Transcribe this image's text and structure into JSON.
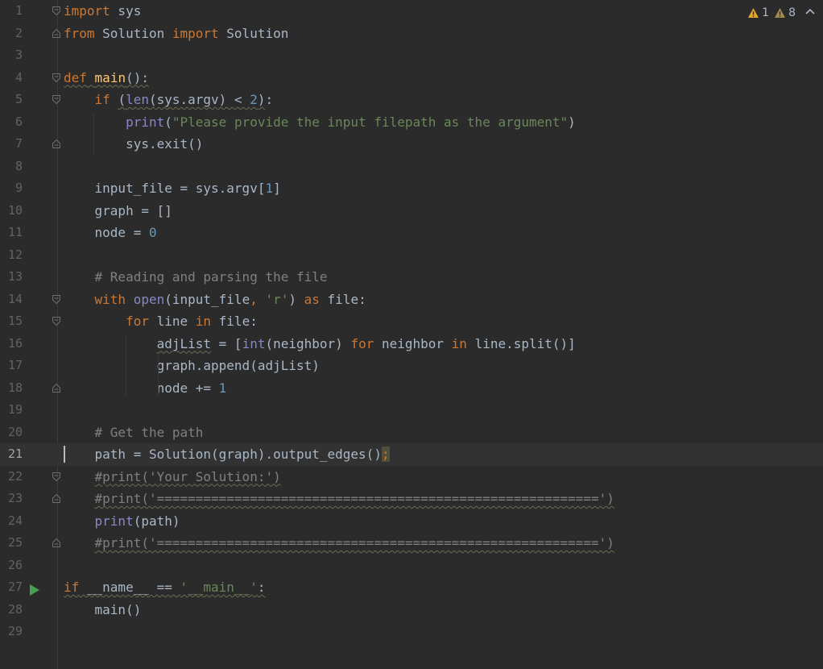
{
  "editor": {
    "current_line": 21,
    "inspections": {
      "warnings_count": "1",
      "weak_warnings_count": "8",
      "warning_color": "#e0a533",
      "weak_warning_color": "#a38b4b",
      "expand_icon": "chevron-up-icon"
    },
    "colors": {
      "background": "#2b2b2b",
      "keyword": "#cc7832",
      "string": "#6a8759",
      "number": "#6897bb",
      "comment": "#808080",
      "function_def": "#ffc66d",
      "builtin": "#8888c6",
      "run_icon": "#499c54"
    },
    "lines": [
      {
        "n": "1",
        "fold": "start",
        "tokens": [
          {
            "t": "import",
            "c": "kw"
          },
          {
            "t": " sys",
            "c": "pl"
          }
        ]
      },
      {
        "n": "2",
        "fold": "end",
        "tokens": [
          {
            "t": "from",
            "c": "kw"
          },
          {
            "t": " Solution ",
            "c": "pl"
          },
          {
            "t": "import",
            "c": "kw"
          },
          {
            "t": " Solution",
            "c": "pl"
          }
        ]
      },
      {
        "n": "3",
        "tokens": []
      },
      {
        "n": "4",
        "fold": "start",
        "tokens": [
          {
            "t": "def",
            "c": "kw sq"
          },
          {
            "t": " ",
            "c": "pl sq"
          },
          {
            "t": "main",
            "c": "fn sq"
          },
          {
            "t": "():",
            "c": "pl sq"
          }
        ]
      },
      {
        "n": "5",
        "fold": "start",
        "tokens": [
          {
            "t": "    "
          },
          {
            "t": "if",
            "c": "kw"
          },
          {
            "t": " ",
            "c": "pl"
          },
          {
            "t": "(",
            "c": "pl sq"
          },
          {
            "t": "len",
            "c": "bi sq"
          },
          {
            "t": "(sys.argv) < ",
            "c": "pl sq"
          },
          {
            "t": "2",
            "c": "num sq"
          },
          {
            "t": ")",
            "c": "pl sq"
          },
          {
            "t": ":",
            "c": "pl"
          }
        ]
      },
      {
        "n": "6",
        "tokens": [
          {
            "t": "        "
          },
          {
            "t": "print",
            "c": "bi"
          },
          {
            "t": "(",
            "c": "pl"
          },
          {
            "t": "\"Please provide the input filepath as the argument\"",
            "c": "str"
          },
          {
            "t": ")",
            "c": "pl"
          }
        ]
      },
      {
        "n": "7",
        "fold": "end",
        "tokens": [
          {
            "t": "        sys.exit()",
            "c": "pl"
          }
        ]
      },
      {
        "n": "8",
        "tokens": []
      },
      {
        "n": "9",
        "tokens": [
          {
            "t": "    input_file = sys.argv[",
            "c": "pl"
          },
          {
            "t": "1",
            "c": "num"
          },
          {
            "t": "]",
            "c": "pl"
          }
        ]
      },
      {
        "n": "10",
        "tokens": [
          {
            "t": "    graph = []",
            "c": "pl"
          }
        ]
      },
      {
        "n": "11",
        "tokens": [
          {
            "t": "    node = ",
            "c": "pl"
          },
          {
            "t": "0",
            "c": "num"
          }
        ]
      },
      {
        "n": "12",
        "tokens": []
      },
      {
        "n": "13",
        "tokens": [
          {
            "t": "    "
          },
          {
            "t": "# Reading and parsing the file",
            "c": "com"
          }
        ]
      },
      {
        "n": "14",
        "fold": "start",
        "tokens": [
          {
            "t": "    "
          },
          {
            "t": "with",
            "c": "kw"
          },
          {
            "t": " ",
            "c": "pl"
          },
          {
            "t": "open",
            "c": "bi"
          },
          {
            "t": "(input_file",
            "c": "pl"
          },
          {
            "t": ", ",
            "c": "kw"
          },
          {
            "t": "'r'",
            "c": "str"
          },
          {
            "t": ") ",
            "c": "pl"
          },
          {
            "t": "as",
            "c": "kw"
          },
          {
            "t": " file:",
            "c": "pl"
          }
        ]
      },
      {
        "n": "15",
        "fold": "start",
        "tokens": [
          {
            "t": "        "
          },
          {
            "t": "for",
            "c": "kw"
          },
          {
            "t": " line ",
            "c": "pl"
          },
          {
            "t": "in",
            "c": "kw"
          },
          {
            "t": " file:",
            "c": "pl"
          }
        ]
      },
      {
        "n": "16",
        "tokens": [
          {
            "t": "            "
          },
          {
            "t": "adjList",
            "c": "pl sq"
          },
          {
            "t": " = [",
            "c": "pl"
          },
          {
            "t": "int",
            "c": "bi"
          },
          {
            "t": "(neighbor) ",
            "c": "pl"
          },
          {
            "t": "for",
            "c": "kw"
          },
          {
            "t": " neighbor ",
            "c": "pl"
          },
          {
            "t": "in",
            "c": "kw"
          },
          {
            "t": " line.split()]",
            "c": "pl"
          }
        ]
      },
      {
        "n": "17",
        "tokens": [
          {
            "t": "            graph.append(adjList)",
            "c": "pl"
          }
        ]
      },
      {
        "n": "18",
        "fold": "end",
        "tokens": [
          {
            "t": "            node += ",
            "c": "pl"
          },
          {
            "t": "1",
            "c": "num"
          }
        ]
      },
      {
        "n": "19",
        "tokens": []
      },
      {
        "n": "20",
        "tokens": [
          {
            "t": "    "
          },
          {
            "t": "# Get the path",
            "c": "com"
          }
        ]
      },
      {
        "n": "21",
        "tokens": [
          {
            "t": "    path = Solution(graph).output_edges()",
            "c": "pl"
          },
          {
            "t": ";",
            "c": "kw semi"
          }
        ]
      },
      {
        "n": "22",
        "fold": "start",
        "tokens": [
          {
            "t": "    "
          },
          {
            "t": "#print('Your Solution:')",
            "c": "com sq"
          }
        ]
      },
      {
        "n": "23",
        "fold": "end",
        "tokens": [
          {
            "t": "    "
          },
          {
            "t": "#print('=========================================================')",
            "c": "com sq"
          }
        ]
      },
      {
        "n": "24",
        "tokens": [
          {
            "t": "    "
          },
          {
            "t": "print",
            "c": "bi"
          },
          {
            "t": "(path)",
            "c": "pl"
          }
        ]
      },
      {
        "n": "25",
        "fold": "end",
        "tokens": [
          {
            "t": "    "
          },
          {
            "t": "#print('=========================================================')",
            "c": "com sq"
          }
        ]
      },
      {
        "n": "26",
        "tokens": []
      },
      {
        "n": "27",
        "run": true,
        "tokens": [
          {
            "t": "if",
            "c": "kw sq"
          },
          {
            "t": " __name__ == ",
            "c": "pl sq"
          },
          {
            "t": "'__main__'",
            "c": "str sq"
          },
          {
            "t": ":",
            "c": "pl sq"
          }
        ]
      },
      {
        "n": "28",
        "tokens": [
          {
            "t": "    main()",
            "c": "pl"
          }
        ]
      },
      {
        "n": "29",
        "tokens": []
      }
    ]
  }
}
